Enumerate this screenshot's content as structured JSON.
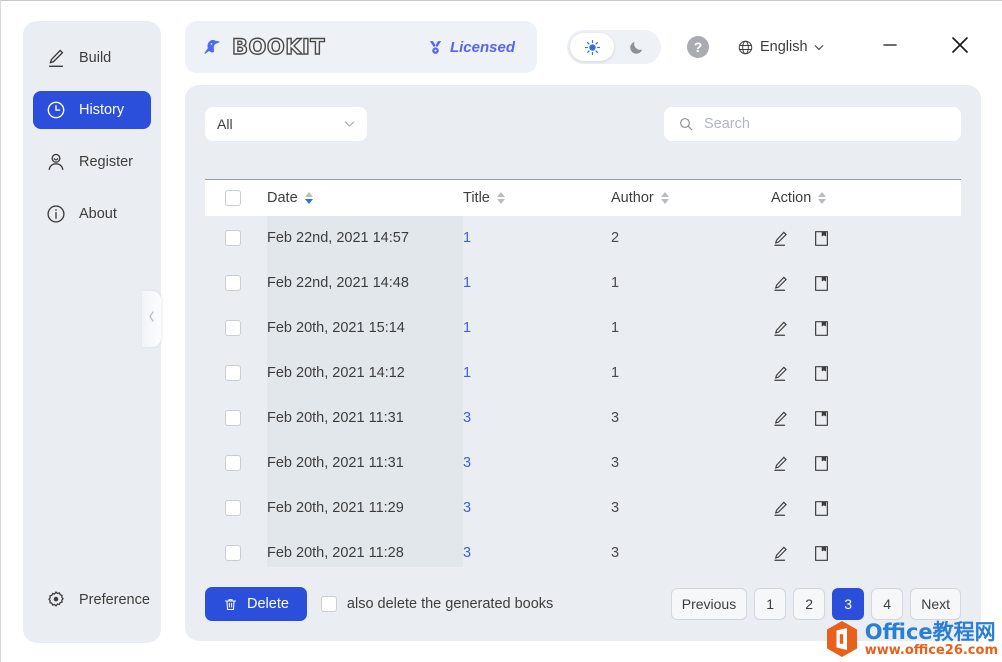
{
  "colors": {
    "accent": "#2c4fdb",
    "link": "#3a63e0",
    "panel_bg": "#eaeef2",
    "window_bg": "#ffffff",
    "licensed": "#5566ee",
    "watermark_blue": "#2a7fd4",
    "watermark_orange": "#e8601c"
  },
  "sidebar": {
    "items": [
      {
        "label": "Build",
        "icon": "pencil-icon",
        "active": false
      },
      {
        "label": "History",
        "icon": "clock-icon",
        "active": true
      },
      {
        "label": "Register",
        "icon": "user-icon",
        "active": false
      },
      {
        "label": "About",
        "icon": "info-icon",
        "active": false
      }
    ],
    "bottom": {
      "label": "Preference",
      "icon": "gear-icon"
    },
    "collapse_handle_icon": "chevron-left-icon"
  },
  "header": {
    "brand_name": "BOOKIT",
    "brand_logo_icon": "kiwi-bird-icon",
    "license_badge": {
      "label": "Licensed",
      "icon": "medal-icon"
    },
    "theme_toggle": {
      "light_icon": "sun-icon",
      "dark_icon": "moon-icon",
      "selected": "light"
    },
    "help_label": "?",
    "language": {
      "label": "English",
      "icon": "globe-icon",
      "caret": "chevron-down-icon"
    },
    "window_controls": {
      "minimize_icon": "minimize-icon",
      "close_icon": "close-icon"
    }
  },
  "filters": {
    "category_select": {
      "value": "All",
      "caret": "chevron-down-icon"
    },
    "search": {
      "value": "",
      "placeholder": "Search",
      "icon": "search-icon"
    }
  },
  "table": {
    "columns": [
      {
        "key": "checkbox",
        "label": "",
        "sortable": false,
        "sort": "none"
      },
      {
        "key": "date",
        "label": "Date",
        "sortable": true,
        "sort": "desc"
      },
      {
        "key": "title",
        "label": "Title",
        "sortable": true,
        "sort": "none"
      },
      {
        "key": "author",
        "label": "Author",
        "sortable": true,
        "sort": "none"
      },
      {
        "key": "action",
        "label": "Action",
        "sortable": true,
        "sort": "none"
      }
    ],
    "header_checkbox_checked": false,
    "row_action_icons": [
      "edit-pencil-icon",
      "book-icon"
    ],
    "rows": [
      {
        "date": "Feb 22nd, 2021 14:57",
        "title": "1",
        "author": "2",
        "checked": false
      },
      {
        "date": "Feb 22nd, 2021 14:48",
        "title": "1",
        "author": "1",
        "checked": false
      },
      {
        "date": "Feb 20th, 2021 15:14",
        "title": "1",
        "author": "1",
        "checked": false
      },
      {
        "date": "Feb 20th, 2021 14:12",
        "title": "1",
        "author": "1",
        "checked": false
      },
      {
        "date": "Feb 20th, 2021 11:31",
        "title": "3",
        "author": "3",
        "checked": false
      },
      {
        "date": "Feb 20th, 2021 11:31",
        "title": "3",
        "author": "3",
        "checked": false
      },
      {
        "date": "Feb 20th, 2021 11:29",
        "title": "3",
        "author": "3",
        "checked": false
      },
      {
        "date": "Feb 20th, 2021 11:28",
        "title": "3",
        "author": "3",
        "checked": false
      }
    ]
  },
  "footer": {
    "delete_button": {
      "label": "Delete",
      "icon": "trash-icon"
    },
    "also_delete": {
      "label": "also delete the generated books",
      "checked": false
    },
    "pagination": {
      "previous_label": "Previous",
      "next_label": "Next",
      "pages": [
        "1",
        "2",
        "3",
        "4"
      ],
      "current_page": "3"
    }
  },
  "watermark": {
    "title": "Office教程网",
    "subtitle": "www.office26.com",
    "icon": "office-hexagon-icon"
  }
}
